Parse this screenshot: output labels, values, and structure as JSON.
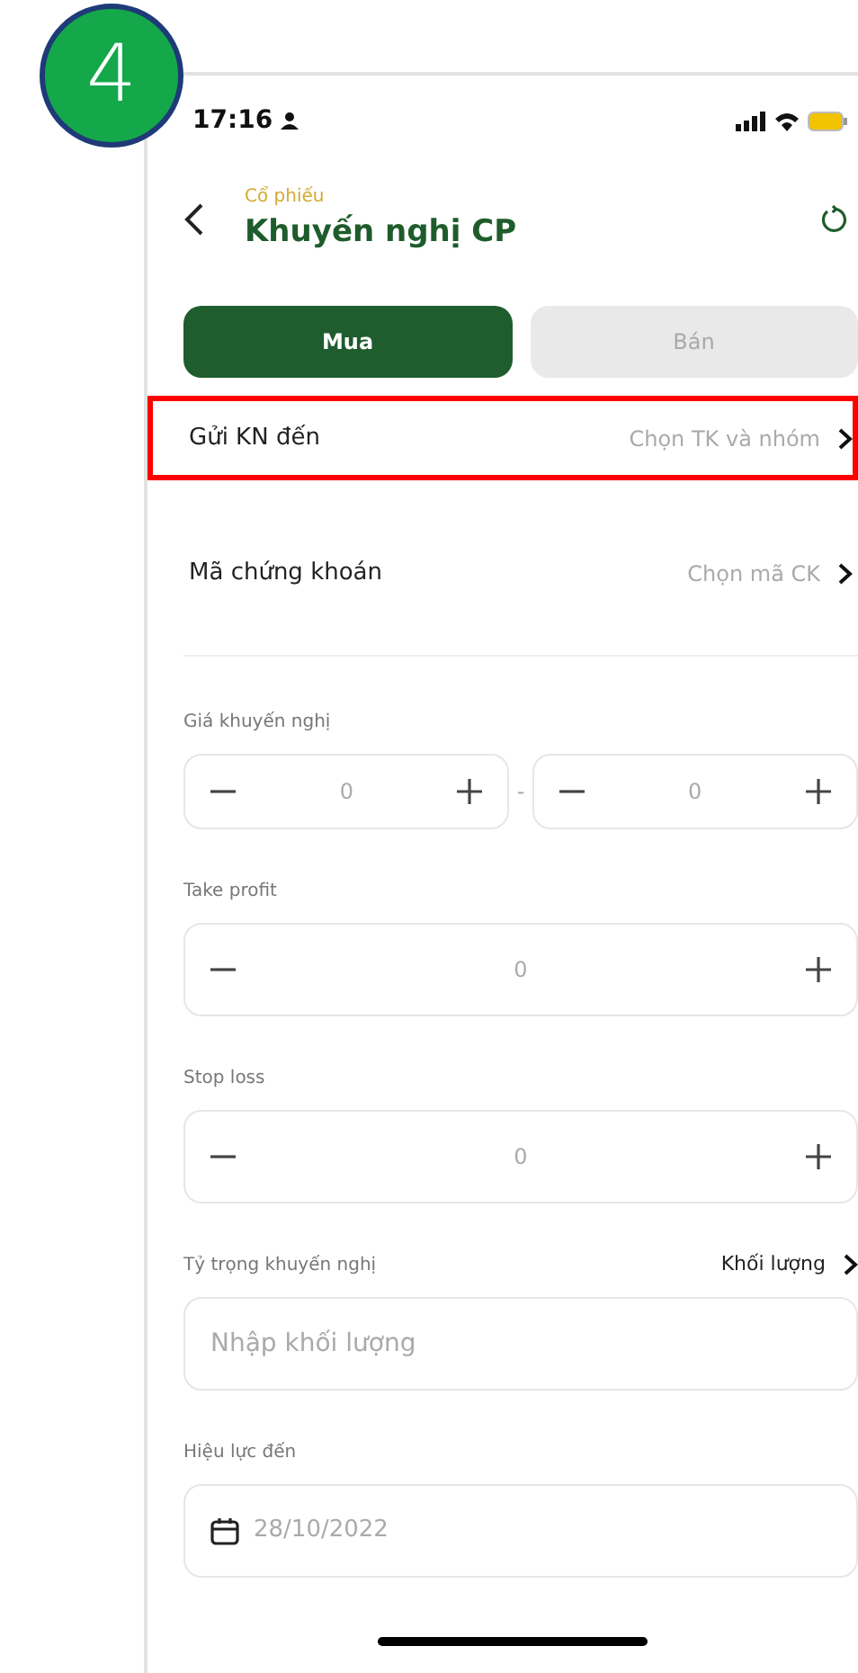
{
  "step_badge": "4",
  "status_bar": {
    "time": "17:16"
  },
  "header": {
    "subtitle": "Cổ phiếu",
    "title": "Khuyến nghị CP"
  },
  "tabs": [
    {
      "label": "Mua",
      "selected": true
    },
    {
      "label": "Bán",
      "selected": false
    }
  ],
  "picker_rows": [
    {
      "label": "Gửi KN đến",
      "value": "Chọn TK và nhóm",
      "highlighted": true
    },
    {
      "label": "Mã chứng khoán",
      "value": "Chọn mã CK",
      "highlighted": false
    }
  ],
  "fields": [
    {
      "kind": "range",
      "label": "Giá khuyến nghị",
      "values": [
        "0",
        "0"
      ],
      "separator": "-"
    },
    {
      "kind": "stepper",
      "label": "Take profit",
      "value": "0"
    },
    {
      "kind": "stepper",
      "label": "Stop loss",
      "value": "0"
    },
    {
      "kind": "input",
      "label": "Tỷ trọng khuyến nghị",
      "option": "Khối lượng",
      "placeholder": "Nhập khối lượng"
    },
    {
      "kind": "date",
      "label": "Hiệu lực đến",
      "value": "28/10/2022"
    }
  ]
}
